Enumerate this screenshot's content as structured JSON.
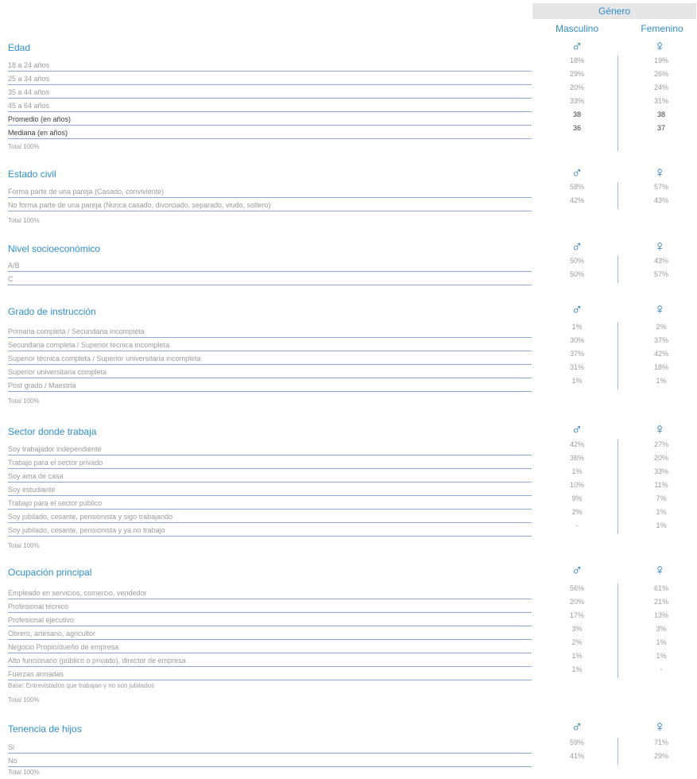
{
  "header": {
    "group": "Género",
    "col_male": "Masculino",
    "col_female": "Femenino"
  },
  "symbols": {
    "male": "♂",
    "female": "♀"
  },
  "colors": {
    "accent": "#2f8fd0",
    "symbol": "#1b75bb",
    "row_line": "#8ea9d8",
    "muted_text": "#9b9b9b"
  },
  "sections": [
    {
      "title": "Edad",
      "rows": [
        {
          "label": "18 a 24 años",
          "m": "18%",
          "f": "19%"
        },
        {
          "label": "25 a 34 años",
          "m": "29%",
          "f": "26%"
        },
        {
          "label": "35 a 44 años",
          "m": "20%",
          "f": "24%"
        },
        {
          "label": "45 a 64 años",
          "m": "33%",
          "f": "31%"
        },
        {
          "label": "Promedio (en años)",
          "m": "38",
          "f": "38",
          "dark": true
        },
        {
          "label": "Mediana (en años)",
          "m": "36",
          "f": "37",
          "dark": true
        }
      ],
      "notes": [
        "Total 100%"
      ]
    },
    {
      "title": "Estado civil",
      "rows": [
        {
          "label": "Forma parte de una pareja (Casado, conviviente)",
          "m": "58%",
          "f": "57%"
        },
        {
          "label": "No forma parte de una pareja (Nunca casado, divorciado, separado, viudo, soltero)",
          "m": "42%",
          "f": "43%"
        }
      ],
      "notes": [
        "Total 100%"
      ]
    },
    {
      "title": "Nivel socioeconómico",
      "rows": [
        {
          "label": "A/B",
          "m": "50%",
          "f": "43%"
        },
        {
          "label": "C",
          "m": "50%",
          "f": "57%"
        }
      ],
      "notes": []
    },
    {
      "title": "Grado de instrucción",
      "rows": [
        {
          "label": "Primaria completa / Secundaria incompleta",
          "m": "1%",
          "f": "2%"
        },
        {
          "label": "Secundaria completa / Superior técnica incompleta",
          "m": "30%",
          "f": "37%"
        },
        {
          "label": "Superior técnica completa / Superior universitaria incompleta",
          "m": "37%",
          "f": "42%"
        },
        {
          "label": "Superior universitaria completa",
          "m": "31%",
          "f": "18%"
        },
        {
          "label": "Post grado / Maestria",
          "m": "1%",
          "f": "1%"
        }
      ],
      "notes": [
        "Total 100%"
      ]
    },
    {
      "title": "Sector donde trabaja",
      "rows": [
        {
          "label": "Soy trabajador independiente",
          "m": "42%",
          "f": "27%"
        },
        {
          "label": "Trabajo para el sector privado",
          "m": "36%",
          "f": "20%"
        },
        {
          "label": "Soy ama de casa",
          "m": "1%",
          "f": "33%"
        },
        {
          "label": "Soy estudiante",
          "m": "10%",
          "f": "11%"
        },
        {
          "label": "Trabajo para el sector público",
          "m": "9%",
          "f": "7%"
        },
        {
          "label": "Soy jubilado, cesante, pensionista  y sigo trabajando",
          "m": "2%",
          "f": "1%"
        },
        {
          "label": "Soy jubilado, cesante, pensionista y ya no trabajo",
          "m": "-",
          "f": "1%"
        }
      ],
      "notes": [
        "Total 100%"
      ]
    },
    {
      "title": "Ocupación principal",
      "rows": [
        {
          "label": "Empleado en servicios, comercio, vendedor",
          "m": "56%",
          "f": "61%"
        },
        {
          "label": "Profesional técnico",
          "m": "20%",
          "f": "21%"
        },
        {
          "label": "Profesional ejecutivo",
          "m": "17%",
          "f": "13%"
        },
        {
          "label": "Obrero, artesano, agricultor",
          "m": "3%",
          "f": "3%"
        },
        {
          "label": "Negocio Propio/dueño de empresa",
          "m": "2%",
          "f": "1%"
        },
        {
          "label": "Alto funcionario (público o privado), director de empresa",
          "m": "1%",
          "f": "1%"
        },
        {
          "label": "Fuerzas armadas",
          "m": "1%",
          "f": "-"
        }
      ],
      "notes": [
        "Base: Entrevistados que trabajan y no son jubilados",
        "Total 100%"
      ]
    },
    {
      "title": "Tenencia de hijos",
      "rows": [
        {
          "label": "Si",
          "m": "59%",
          "f": "71%"
        },
        {
          "label": "No",
          "m": "41%",
          "f": "29%"
        }
      ],
      "notes": [
        "Total 100%"
      ]
    }
  ]
}
